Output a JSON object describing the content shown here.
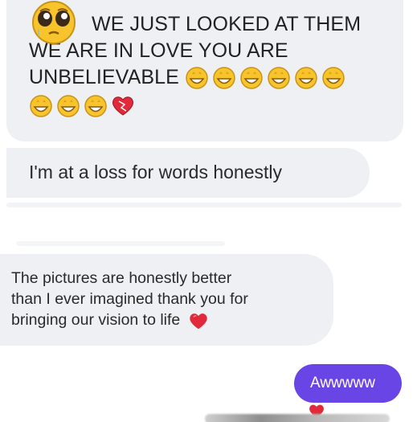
{
  "messages": [
    {
      "lines": [
        "WE JUST LOOKED AT THEM",
        "WE ARE IN LOVE YOU ARE",
        "UNBELIEVABLE"
      ],
      "emoji_icons": [
        "pleading-face-icon",
        "star-struck-icon",
        "heart-icon"
      ]
    },
    {
      "text": "I'm at a loss for words honestly"
    },
    {
      "lines": [
        "The pictures are honestly better",
        "than I ever imagined thank you for",
        "bringing our vision to life"
      ],
      "emoji_icons": [
        "heart-icon"
      ]
    }
  ],
  "sent_message": {
    "text": "Awwwww",
    "reaction": "heart-icon"
  },
  "colors": {
    "received_bubble": "#eef0f3",
    "sent_bubble": "#6a45e6",
    "heart": "#e0293a",
    "emoji_yellow": "#f7c52b"
  }
}
